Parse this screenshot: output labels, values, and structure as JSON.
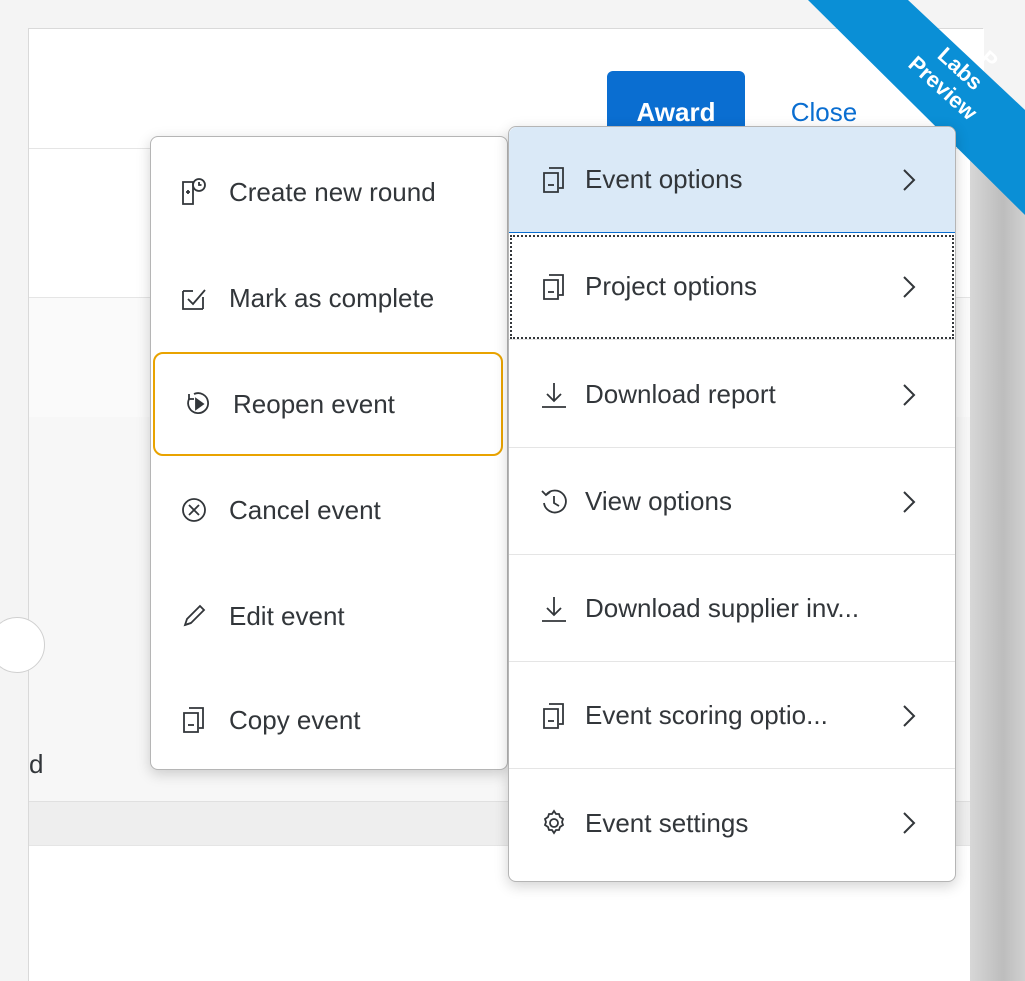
{
  "header": {
    "award_label": "Award",
    "close_label": "Close"
  },
  "ribbon": {
    "line1": "SAP",
    "line2": "Labs",
    "line3": "Preview",
    "color": "#0a8fd6"
  },
  "background": {
    "partial_text": "d"
  },
  "submenu": {
    "items": [
      {
        "label": "Create new round",
        "icon": "new-round-icon"
      },
      {
        "label": "Mark as complete",
        "icon": "checkbox-icon"
      },
      {
        "label": "Reopen event",
        "icon": "reopen-icon",
        "focused": true
      },
      {
        "label": "Cancel event",
        "icon": "cancel-icon"
      },
      {
        "label": "Edit event",
        "icon": "pencil-icon"
      },
      {
        "label": "Copy event",
        "icon": "copy-icon"
      }
    ]
  },
  "main_menu": {
    "items": [
      {
        "label": "Event options",
        "icon": "copy-icon",
        "selected": true
      },
      {
        "label": "Project options",
        "icon": "copy-icon"
      },
      {
        "label": "Download report",
        "icon": "download-icon"
      },
      {
        "label": "View options",
        "icon": "history-icon"
      },
      {
        "label": "Download supplier inv...",
        "icon": "download-icon"
      },
      {
        "label": "Event scoring optio...",
        "icon": "copy-icon"
      },
      {
        "label": "Event settings",
        "icon": "gear-icon"
      }
    ]
  },
  "colors": {
    "brand_blue": "#0a6ed1",
    "selected_bg": "#dae9f7",
    "focus_outline": "#e9a300"
  }
}
